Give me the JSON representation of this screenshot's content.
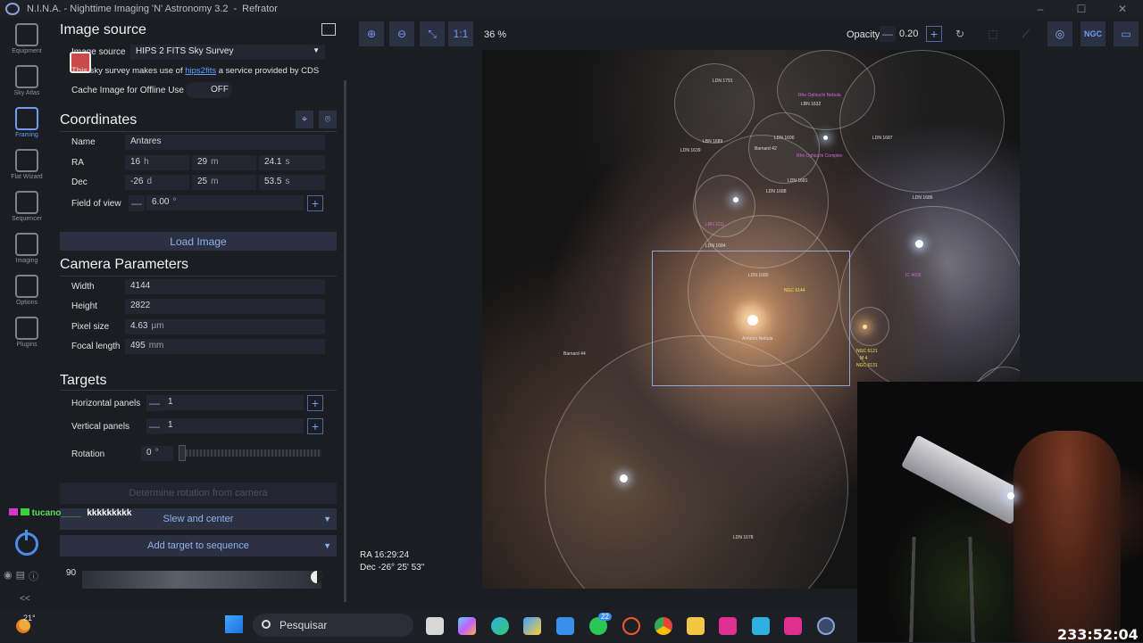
{
  "window": {
    "title": "N.I.N.A. - Nighttime Imaging 'N' Astronomy 3.2",
    "profile": "Refrator"
  },
  "sidebar": {
    "items": [
      {
        "label": "Equipment"
      },
      {
        "label": "Sky Atlas"
      },
      {
        "label": "Framing"
      },
      {
        "label": "Flat Wizard"
      },
      {
        "label": "Sequencer"
      },
      {
        "label": "Imaging"
      },
      {
        "label": "Options"
      },
      {
        "label": "Plugins"
      }
    ],
    "collapse": "<<"
  },
  "image_source": {
    "heading": "Image source",
    "label": "Image source",
    "value": "HIPS 2 FITS Sky Survey",
    "info_prefix": "This sky survey makes use of",
    "info_link": "hips2fits",
    "info_suffix": "a service provided by CDS",
    "cache_label": "Cache Image for Offline Use",
    "cache_value": "OFF"
  },
  "coordinates": {
    "heading": "Coordinates",
    "name_label": "Name",
    "name_value": "Antares",
    "ra_label": "RA",
    "ra_h": "16",
    "ra_h_unit": "h",
    "ra_m": "29",
    "ra_m_unit": "m",
    "ra_s": "24.1",
    "ra_s_unit": "s",
    "dec_label": "Dec",
    "dec_d": "-26",
    "dec_d_unit": "d",
    "dec_m": "25",
    "dec_m_unit": "m",
    "dec_s": "53.5",
    "dec_s_unit": "s",
    "fov_label": "Field of view",
    "fov_value": "6.00",
    "fov_unit": "°"
  },
  "load_image": "Load Image",
  "camera": {
    "heading": "Camera Parameters",
    "width_label": "Width",
    "width_value": "4144",
    "height_label": "Height",
    "height_value": "2822",
    "pixel_label": "Pixel size",
    "pixel_value": "4.63",
    "pixel_unit": "µm",
    "focal_label": "Focal length",
    "focal_value": "495",
    "focal_unit": "mm"
  },
  "targets": {
    "heading": "Targets",
    "hpanels_label": "Horizontal panels",
    "hpanels_value": "1",
    "vpanels_label": "Vertical panels",
    "vpanels_value": "1",
    "rotation_label": "Rotation",
    "rotation_value": "0",
    "rotation_unit": "°",
    "determine_rotation": "Determine rotation from camera",
    "slew_center": "Slew and center",
    "add_target": "Add target to sequence",
    "altitude_label": "90"
  },
  "toolbar": {
    "one_to_one": "1:1",
    "zoom": "36 %",
    "opacity_label": "Opacity",
    "opacity_value": "0.20",
    "ngc": "NGC"
  },
  "sky": {
    "cursor_ra": "RA  16:29:24",
    "cursor_dec": "Dec  -26° 25' 53\"",
    "labels": [
      "LDN 1791",
      "LBN 1632",
      "Rho Ophiuchi Nebula",
      "LDN 1639",
      "LBN 1689",
      "Barnard 42",
      "LDN 1690",
      "LDN 1681",
      "LDN 1688",
      "LDN 1687",
      "LDN 1686",
      "Rho Ophiuchi Complex",
      "LDN 1684",
      "LDN 1680",
      "NGC 6144",
      "Antares Nebula",
      "Barnard 44",
      "NGC 6121",
      "M 4",
      "NGC 6131",
      "LDN 1678",
      "IC 4606",
      "LBN 1111"
    ]
  },
  "chat": {
    "user": "tucano____",
    "message": "kkkkkkkkk"
  },
  "stream": {
    "elapsed": "233:52:04"
  },
  "taskbar": {
    "search": "Pesquisar",
    "temperature": "21°",
    "whatsapp_badge": "22"
  }
}
